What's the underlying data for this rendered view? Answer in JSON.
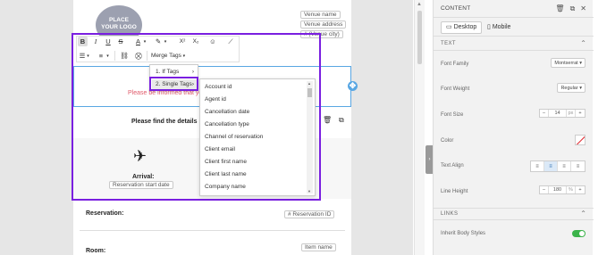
{
  "email": {
    "logo_text": "PLACE\nYOUR LOGO",
    "venue_name": "Venue name",
    "venue_address": "Venue address",
    "venue_city": "# (Venue city)",
    "notice_text": "Please be informed that yo",
    "find_details": "Please find the details",
    "arrival_label": "Arrival:",
    "arrival_value": "Reservation start date",
    "reservation_label": "Reservation:",
    "reservation_value": "# Reservation ID",
    "room_label": "Room:",
    "room_value": "Item name"
  },
  "toolbar": {
    "bold": "B",
    "italic": "I",
    "underline": "U",
    "strike": "S",
    "font_color": "A",
    "highlight": "▾",
    "superscript": "X²",
    "subscript": "X₂",
    "emoji": "☺",
    "clear": "⟋",
    "merge_tags": "Merge Tags"
  },
  "merge_menu": {
    "items": [
      "1. If Tags",
      "2. Single Tags"
    ]
  },
  "single_tags": [
    "Account id",
    "Agent id",
    "Cancellation date",
    "Cancellation type",
    "Channel of reservation",
    "Client email",
    "Client first name",
    "Client last name",
    "Company name"
  ],
  "panel": {
    "title": "CONTENT",
    "tabs": [
      "Desktop",
      "Mobile"
    ],
    "text_section": "TEXT",
    "font_family_label": "Font Family",
    "font_family_value": "Montserrat",
    "font_weight_label": "Font Weight",
    "font_weight_value": "Regular",
    "font_size_label": "Font Size",
    "font_size_value": "14",
    "font_size_unit": "px",
    "color_label": "Color",
    "text_align_label": "Text Align",
    "line_height_label": "Line Height",
    "line_height_value": "180",
    "line_height_unit": "%",
    "links_section": "LINKS",
    "inherit_label": "Inherit Body Styles"
  },
  "colors": {
    "selection": "#7a1fe0",
    "accent_blue": "#59a7e3",
    "toggle_on": "#3bb34a",
    "notice_pink": "#e05a6a"
  }
}
